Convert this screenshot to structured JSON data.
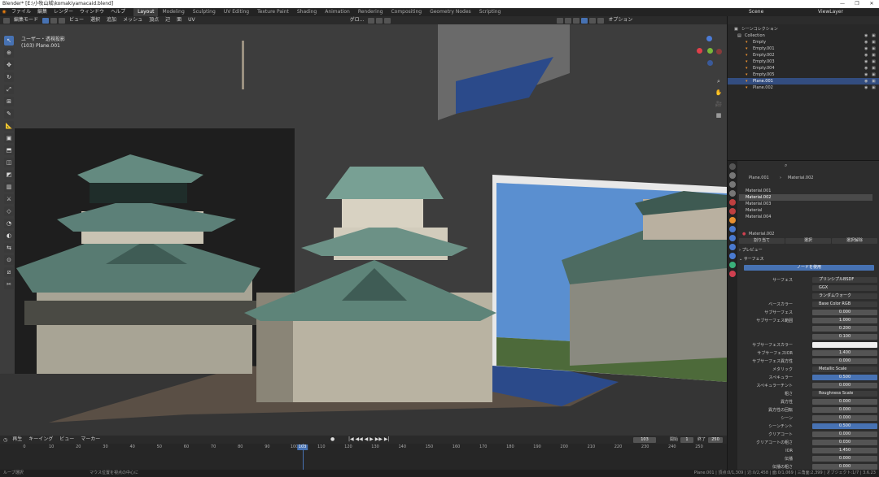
{
  "window": {
    "title": "Blender* [E:\\小牧山城\\komakiyamacaid.blend]",
    "controls": [
      "—",
      "❐",
      "✕"
    ]
  },
  "topbar": {
    "menus": [
      "ファイル",
      "編集",
      "レンダー",
      "ウィンドウ",
      "ヘルプ"
    ],
    "workspaces": [
      "Layout",
      "Modeling",
      "Sculpting",
      "UV Editing",
      "Texture Paint",
      "Shading",
      "Animation",
      "Rendering",
      "Compositing",
      "Geometry Nodes",
      "Scripting"
    ],
    "active_workspace": "Layout",
    "scene": "Scene",
    "view_layer": "ViewLayer"
  },
  "viewport_header": {
    "mode": "編集モード",
    "menus": [
      "ビュー",
      "選択",
      "追加",
      "メッシュ",
      "頂点",
      "辺",
      "面",
      "UV"
    ],
    "transform": "グロ...",
    "options": "オプション"
  },
  "viewport": {
    "view_name": "ユーザー・透視投影",
    "object_info": "(103) Plane.001"
  },
  "toolbar": {
    "tools": [
      "select",
      "cursor",
      "move",
      "rotate",
      "scale",
      "transform",
      "annotate",
      "measure",
      "add-cube",
      "extrude",
      "inset",
      "bevel",
      "loop-cut",
      "knife",
      "poly-build",
      "spin",
      "smooth",
      "edge-slide",
      "shrink-fatten",
      "shear",
      "rip"
    ]
  },
  "timeline": {
    "menus": [
      "再生",
      "キーイング",
      "ビュー",
      "マーカー"
    ],
    "current_frame": "103",
    "start_label": "開始",
    "start": "1",
    "end_label": "終了",
    "end": "250",
    "ticks": [
      "0",
      "10",
      "20",
      "30",
      "40",
      "50",
      "60",
      "70",
      "80",
      "90",
      "100",
      "110",
      "120",
      "130",
      "140",
      "150",
      "160",
      "170",
      "180",
      "190",
      "200",
      "210",
      "220",
      "230",
      "240",
      "250"
    ]
  },
  "statusbar": {
    "left": "ループ選択",
    "middle": "マウス位置を視点の中心に",
    "right": "Plane.001 | 頂点:0/1,309 | 辺:0/2,458 | 面:0/1,069 | 三角面:2,399 | オブジェクト:1/7 | 3.6.23"
  },
  "outliner": {
    "scene_collection": "シーンコレクション",
    "items": [
      {
        "label": "Collection",
        "indent": 0,
        "selected": false
      },
      {
        "label": "Empty",
        "indent": 1,
        "selected": false
      },
      {
        "label": "Empty.001",
        "indent": 1,
        "selected": false
      },
      {
        "label": "Empty.002",
        "indent": 1,
        "selected": false
      },
      {
        "label": "Empty.003",
        "indent": 1,
        "selected": false
      },
      {
        "label": "Empty.004",
        "indent": 1,
        "selected": false
      },
      {
        "label": "Empty.005",
        "indent": 1,
        "selected": false
      },
      {
        "label": "Plane.001",
        "indent": 1,
        "selected": true
      },
      {
        "label": "Plane.002",
        "indent": 1,
        "selected": false
      }
    ]
  },
  "properties": {
    "object": "Plane.001",
    "material": "Material.002",
    "slots": [
      "Material.001",
      "Material.002",
      "Material.003",
      "Material",
      "Material.004"
    ],
    "selected_slot": "Material.002",
    "buttons": [
      "割り当て",
      "選択",
      "選択解除"
    ],
    "sections": {
      "preview": "プレビュー",
      "surface": "サーフェス"
    },
    "use_nodes": "ノードを使用",
    "rows": [
      {
        "label": "サーフェス",
        "value": "プリンシプルBSDF",
        "style": "dark"
      },
      {
        "label": "",
        "value": "GGX",
        "style": "dark"
      },
      {
        "label": "",
        "value": "ランダムウォーク",
        "style": "dark"
      },
      {
        "label": "ベースカラー",
        "value": "Base Color RGB",
        "style": "dark"
      },
      {
        "label": "サブサーフェス",
        "value": "0.000",
        "style": "num"
      },
      {
        "label": "サブサーフェス範囲",
        "value": "1.000",
        "style": "num"
      },
      {
        "label": "",
        "value": "0.200",
        "style": "num"
      },
      {
        "label": "",
        "value": "0.100",
        "style": "num"
      },
      {
        "label": "サブサーフェスカラー",
        "value": "",
        "style": "white"
      },
      {
        "label": "サブサーフェスIOR",
        "value": "1.400",
        "style": "num"
      },
      {
        "label": "サブサーフェス異方性",
        "value": "0.000",
        "style": "num"
      },
      {
        "label": "メタリック",
        "value": "Metallic Scale",
        "style": "dark"
      },
      {
        "label": "スペキュラー",
        "value": "0.500",
        "style": "blue"
      },
      {
        "label": "スペキュラーチント",
        "value": "0.000",
        "style": "num"
      },
      {
        "label": "粗さ",
        "value": "Roughness Scale",
        "style": "dark"
      },
      {
        "label": "異方性",
        "value": "0.000",
        "style": "num"
      },
      {
        "label": "異方性の回転",
        "value": "0.000",
        "style": "num"
      },
      {
        "label": "シーン",
        "value": "0.000",
        "style": "num"
      },
      {
        "label": "シーンチント",
        "value": "0.500",
        "style": "blue"
      },
      {
        "label": "クリアコート",
        "value": "0.000",
        "style": "num"
      },
      {
        "label": "クリアコートの粗さ",
        "value": "0.030",
        "style": "num"
      },
      {
        "label": "IOR",
        "value": "1.450",
        "style": "num"
      },
      {
        "label": "伝播",
        "value": "0.000",
        "style": "num"
      },
      {
        "label": "伝播の粗さ",
        "value": "0.000",
        "style": "num"
      }
    ]
  }
}
